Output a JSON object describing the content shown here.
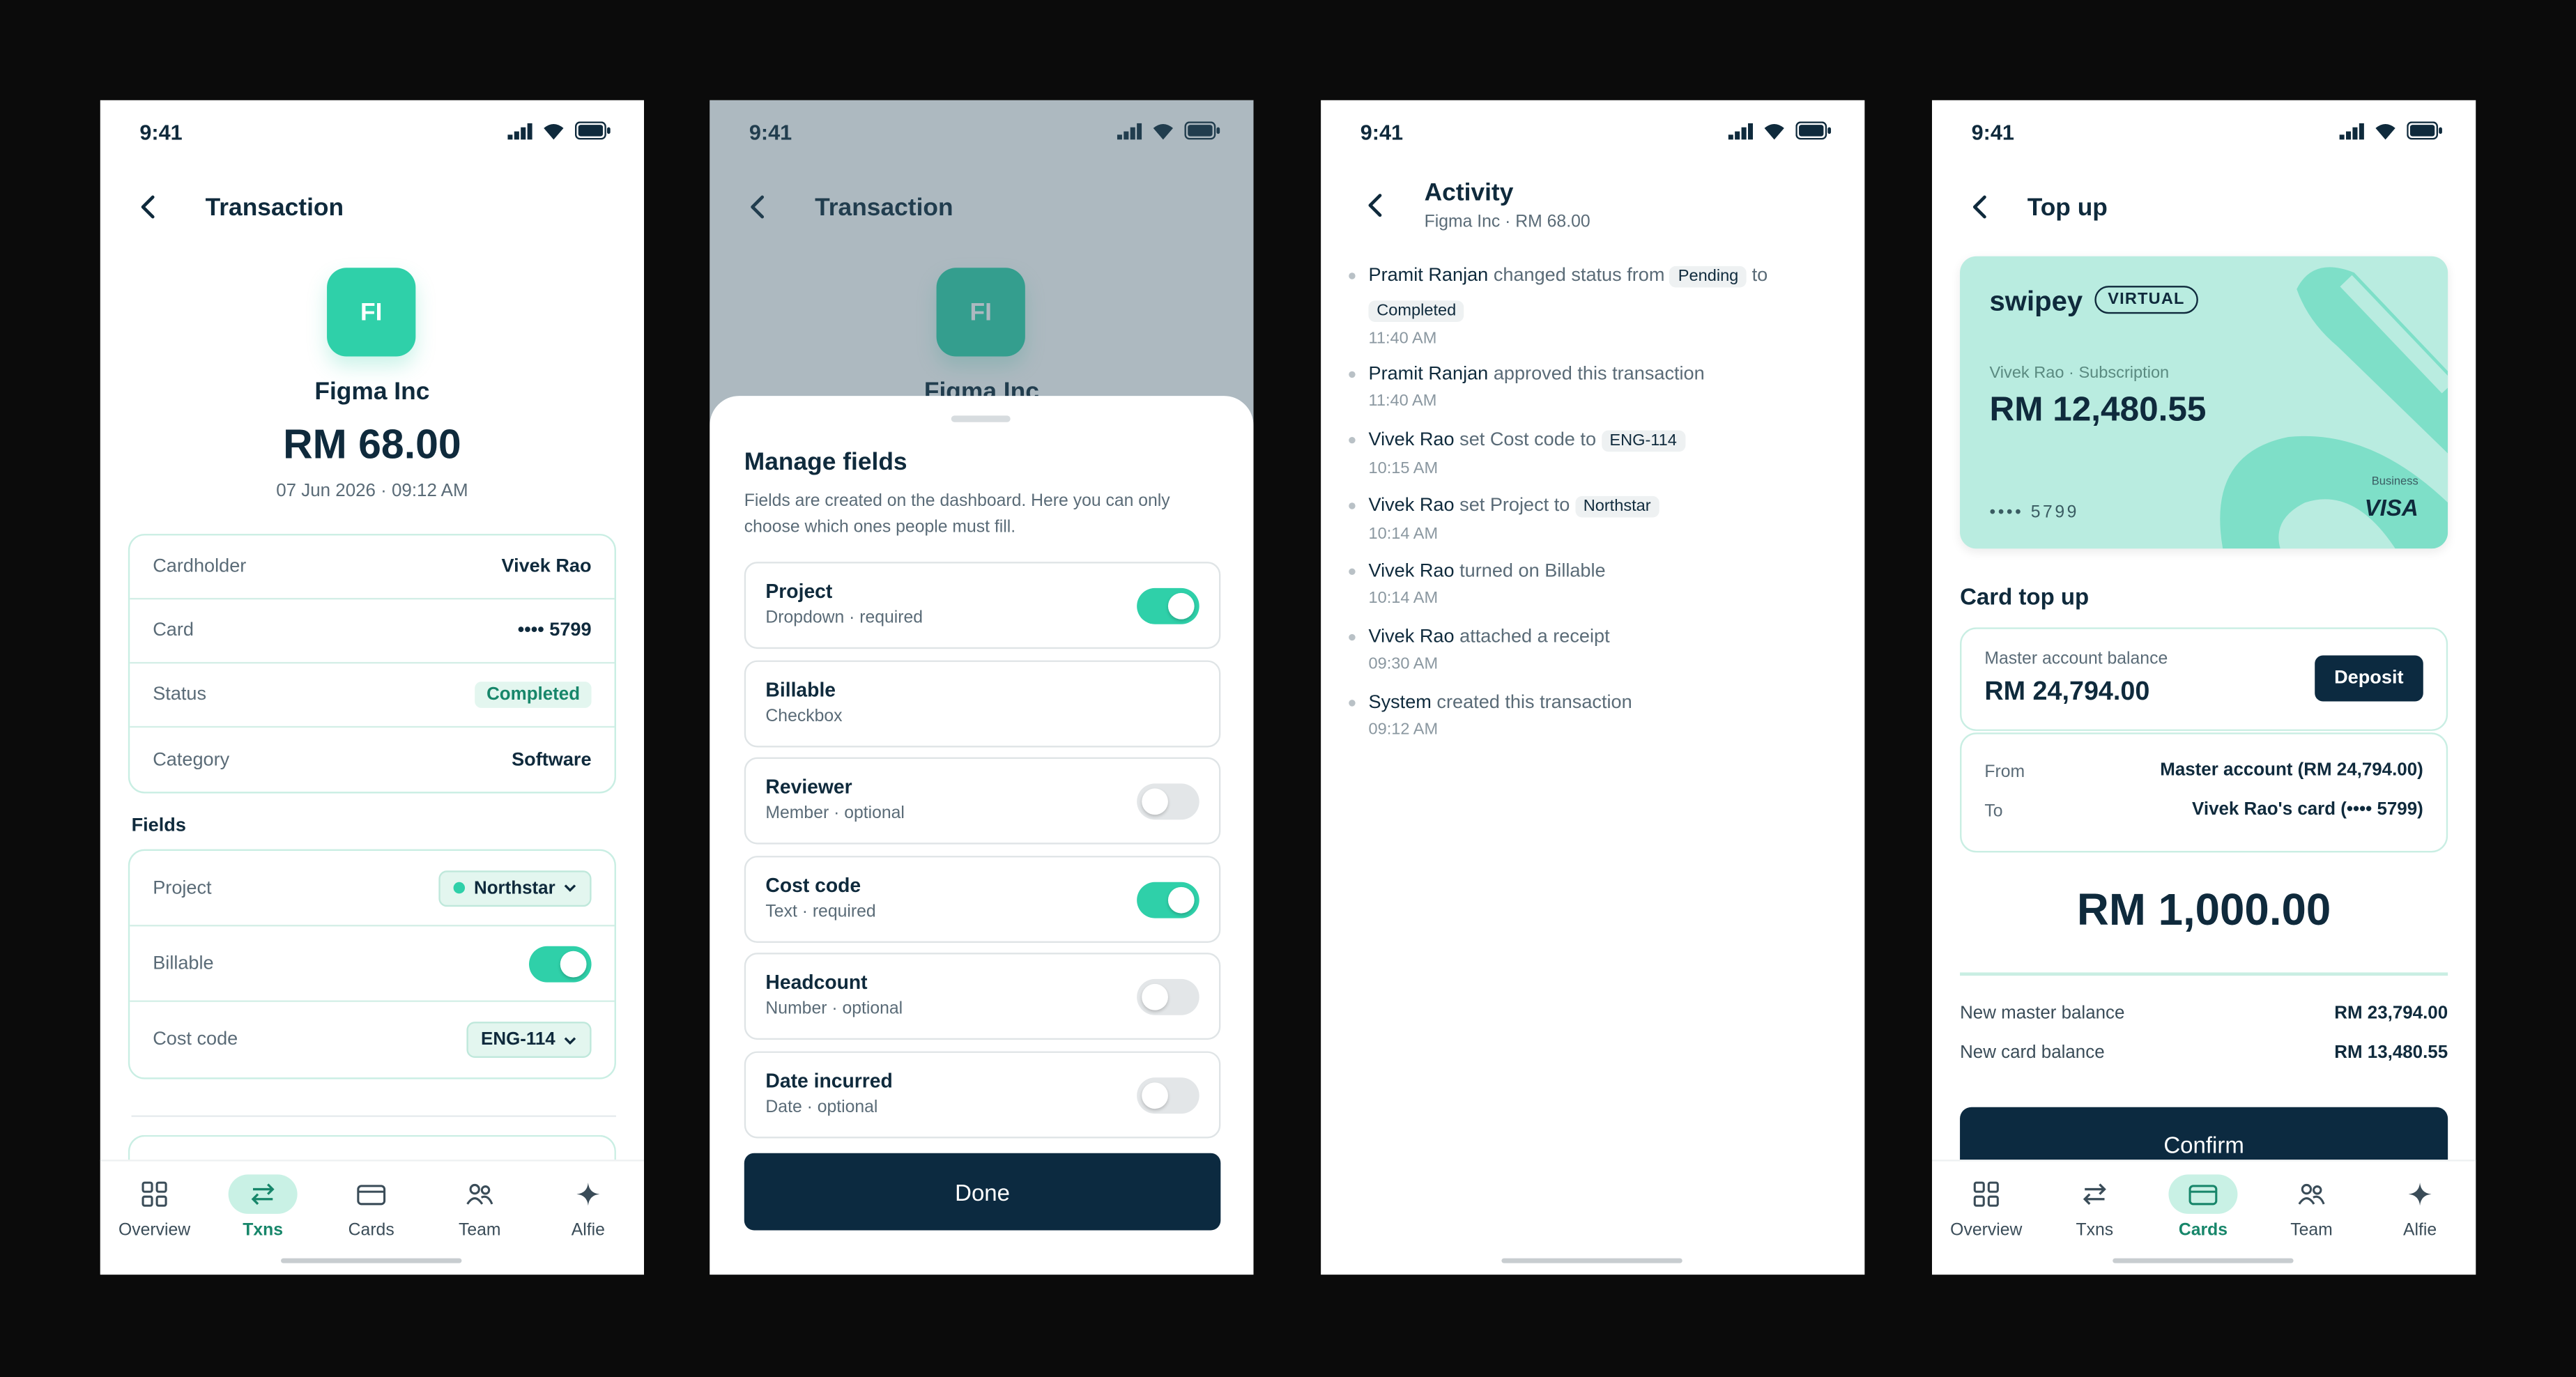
{
  "status": {
    "time": "9:41"
  },
  "tabs": [
    "Overview",
    "Txns",
    "Cards",
    "Team",
    "Alfie"
  ],
  "colors": {
    "accent": "#2fd0a9",
    "navy": "#0c2a40",
    "text": "#0f2a3c",
    "muted": "#5a6b77"
  },
  "screen1": {
    "title": "Transaction",
    "avatar": "FI",
    "merchant": "Figma Inc",
    "amount": "RM 68.00",
    "date": "07 Jun 2026 · 09:12 AM",
    "details": [
      {
        "k": "Cardholder",
        "v": "Vivek Rao"
      },
      {
        "k": "Card",
        "v": "•••• 5799"
      },
      {
        "k": "Status",
        "v": "Completed"
      },
      {
        "k": "Category",
        "v": "Software"
      }
    ],
    "fields_label": "Fields",
    "fields": {
      "project_k": "Project",
      "project_v": "Northstar",
      "billable_k": "Billable",
      "billable_on": true,
      "cost_k": "Cost code",
      "cost_v": "ENG-114"
    },
    "active_tab": "Txns"
  },
  "screen2": {
    "title": "Transaction",
    "avatar": "FI",
    "merchant": "Figma Inc",
    "sheet_title": "Manage fields",
    "sheet_desc": "Fields are created on the dashboard. Here you can only choose which ones people must fill.",
    "fields": [
      {
        "name": "Project",
        "sub": "Dropdown · required",
        "toggle": "on"
      },
      {
        "name": "Billable",
        "sub": "Checkbox",
        "toggle": "none"
      },
      {
        "name": "Reviewer",
        "sub": "Member · optional",
        "toggle": "off"
      },
      {
        "name": "Cost code",
        "sub": "Text · required",
        "toggle": "on"
      },
      {
        "name": "Headcount",
        "sub": "Number · optional",
        "toggle": "off"
      },
      {
        "name": "Date incurred",
        "sub": "Date · optional",
        "toggle": "off"
      }
    ],
    "done": "Done"
  },
  "screen3": {
    "title": "Activity",
    "subtitle": "Figma Inc · RM 68.00",
    "items": [
      {
        "who": "Pramit Ranjan",
        "a": "changed status from",
        "t1": "Pending",
        "b": "to",
        "t2": "Completed",
        "time": "11:40 AM"
      },
      {
        "who": "Pramit Ranjan",
        "a": "approved this transaction",
        "time": "11:40 AM"
      },
      {
        "who": "Vivek Rao",
        "a": "set Cost code to",
        "t1": "ENG-114",
        "time": "10:15 AM"
      },
      {
        "who": "Vivek Rao",
        "a": "set Project to",
        "t1": "Northstar",
        "time": "10:14 AM"
      },
      {
        "who": "Vivek Rao",
        "a": "turned on Billable",
        "time": "10:14 AM"
      },
      {
        "who": "Vivek Rao",
        "a": "attached a receipt",
        "time": "09:30 AM"
      },
      {
        "who": "System",
        "a": "created this transaction",
        "time": "09:12 AM"
      }
    ]
  },
  "screen4": {
    "title": "Top up",
    "card": {
      "brand": "swipey",
      "badge": "VIRTUAL",
      "holder": "Vivek Rao · Subscription",
      "balance": "RM 12,480.55",
      "number": "•••• 5799",
      "tier": "Business",
      "network": "VISA"
    },
    "section": "Card top up",
    "master_label": "Master account balance",
    "master_value": "RM 24,794.00",
    "deposit": "Deposit",
    "from_k": "From",
    "from_v": "Master account (RM 24,794.00)",
    "to_k": "To",
    "to_v": "Vivek Rao's card (•••• 5799)",
    "amount": "RM 1,000.00",
    "new_master_k": "New master balance",
    "new_master_v": "RM 23,794.00",
    "new_card_k": "New card balance",
    "new_card_v": "RM 13,480.55",
    "confirm": "Confirm",
    "active_tab": "Cards"
  }
}
